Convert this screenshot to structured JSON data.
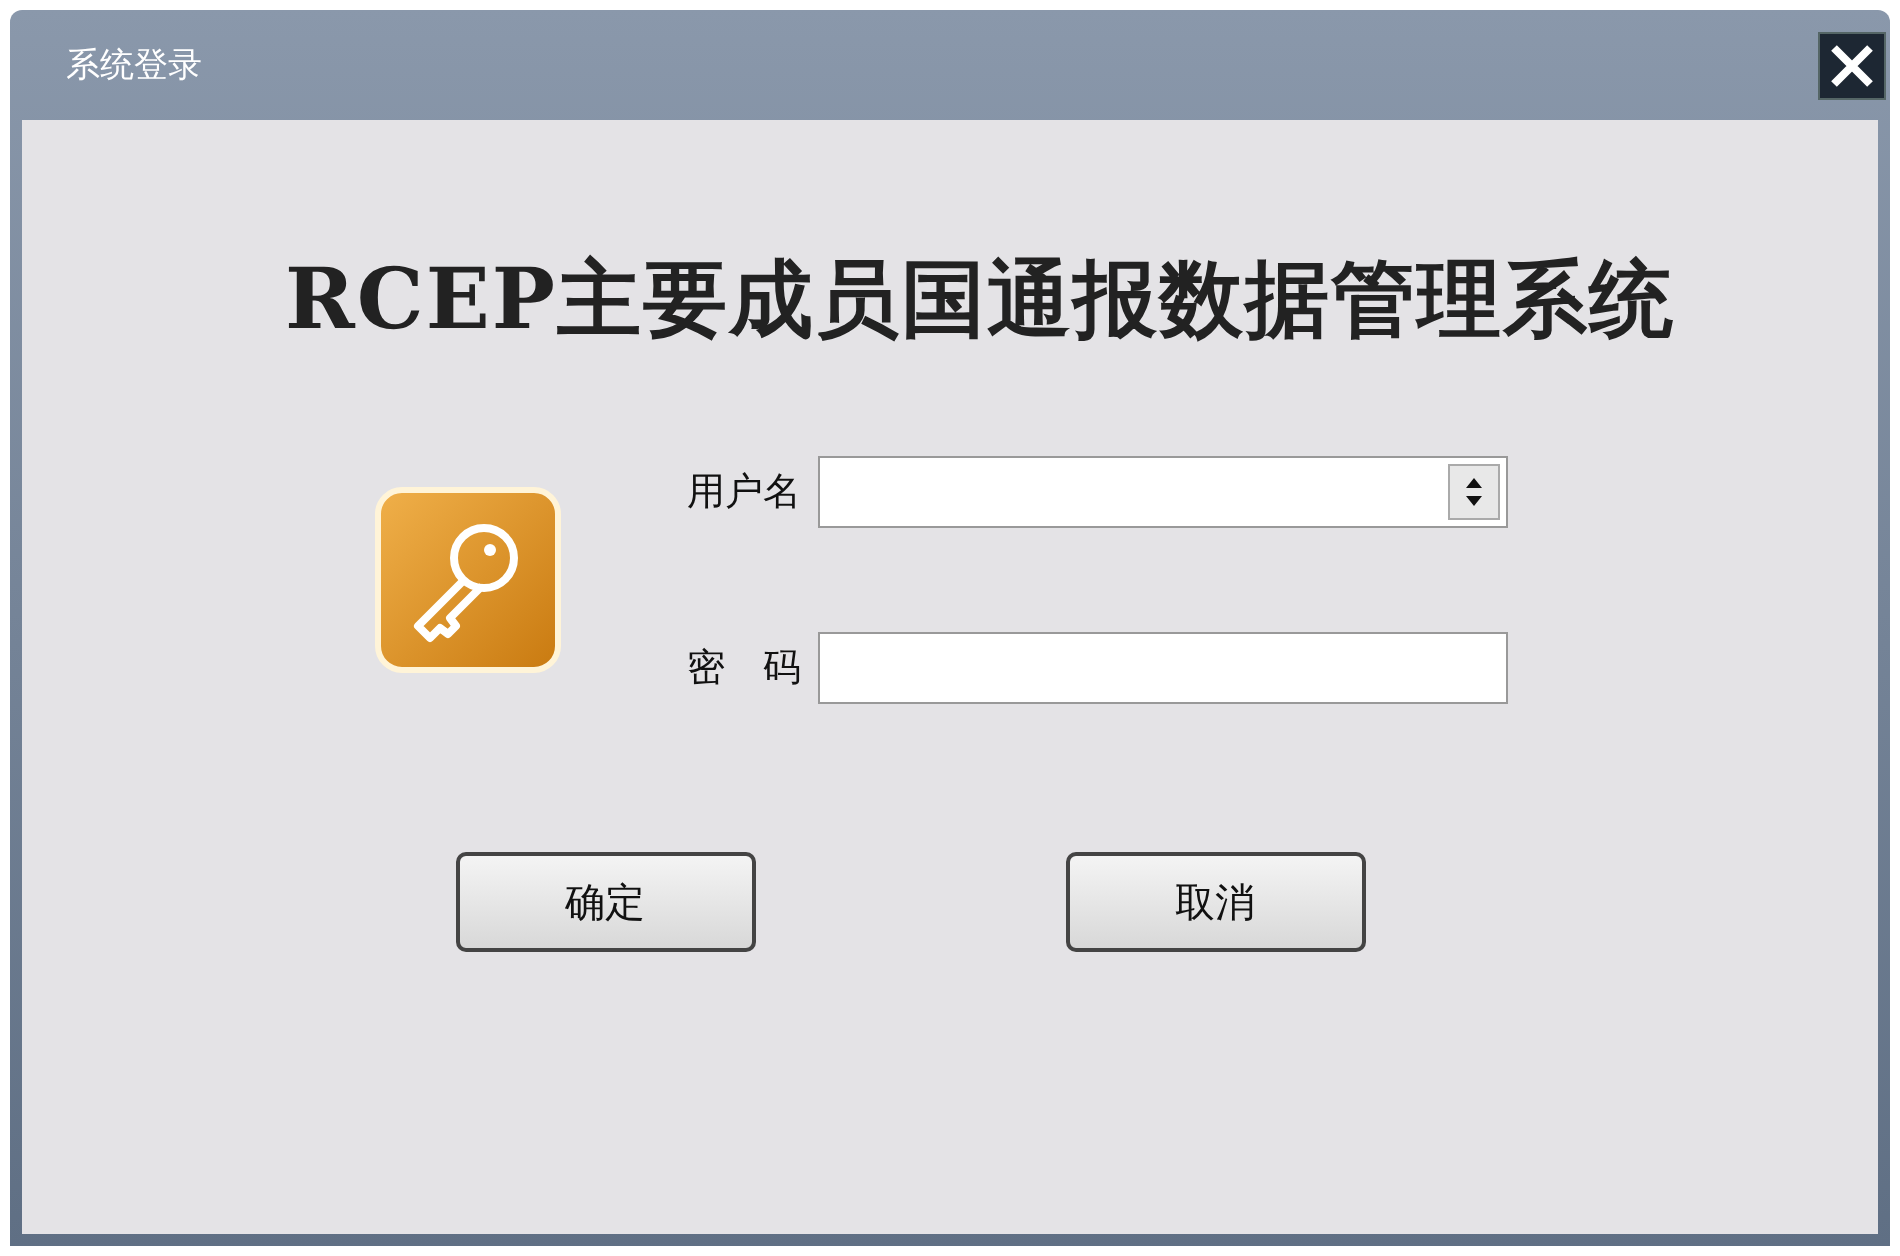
{
  "window": {
    "title": "系统登录"
  },
  "heading": "RCEP主要成员国通报数据管理系统",
  "fields": [
    {
      "label": "用户名",
      "kind": "combo"
    },
    {
      "label": "密　码",
      "kind": "password"
    }
  ],
  "buttons": [
    "确定",
    "取消"
  ]
}
